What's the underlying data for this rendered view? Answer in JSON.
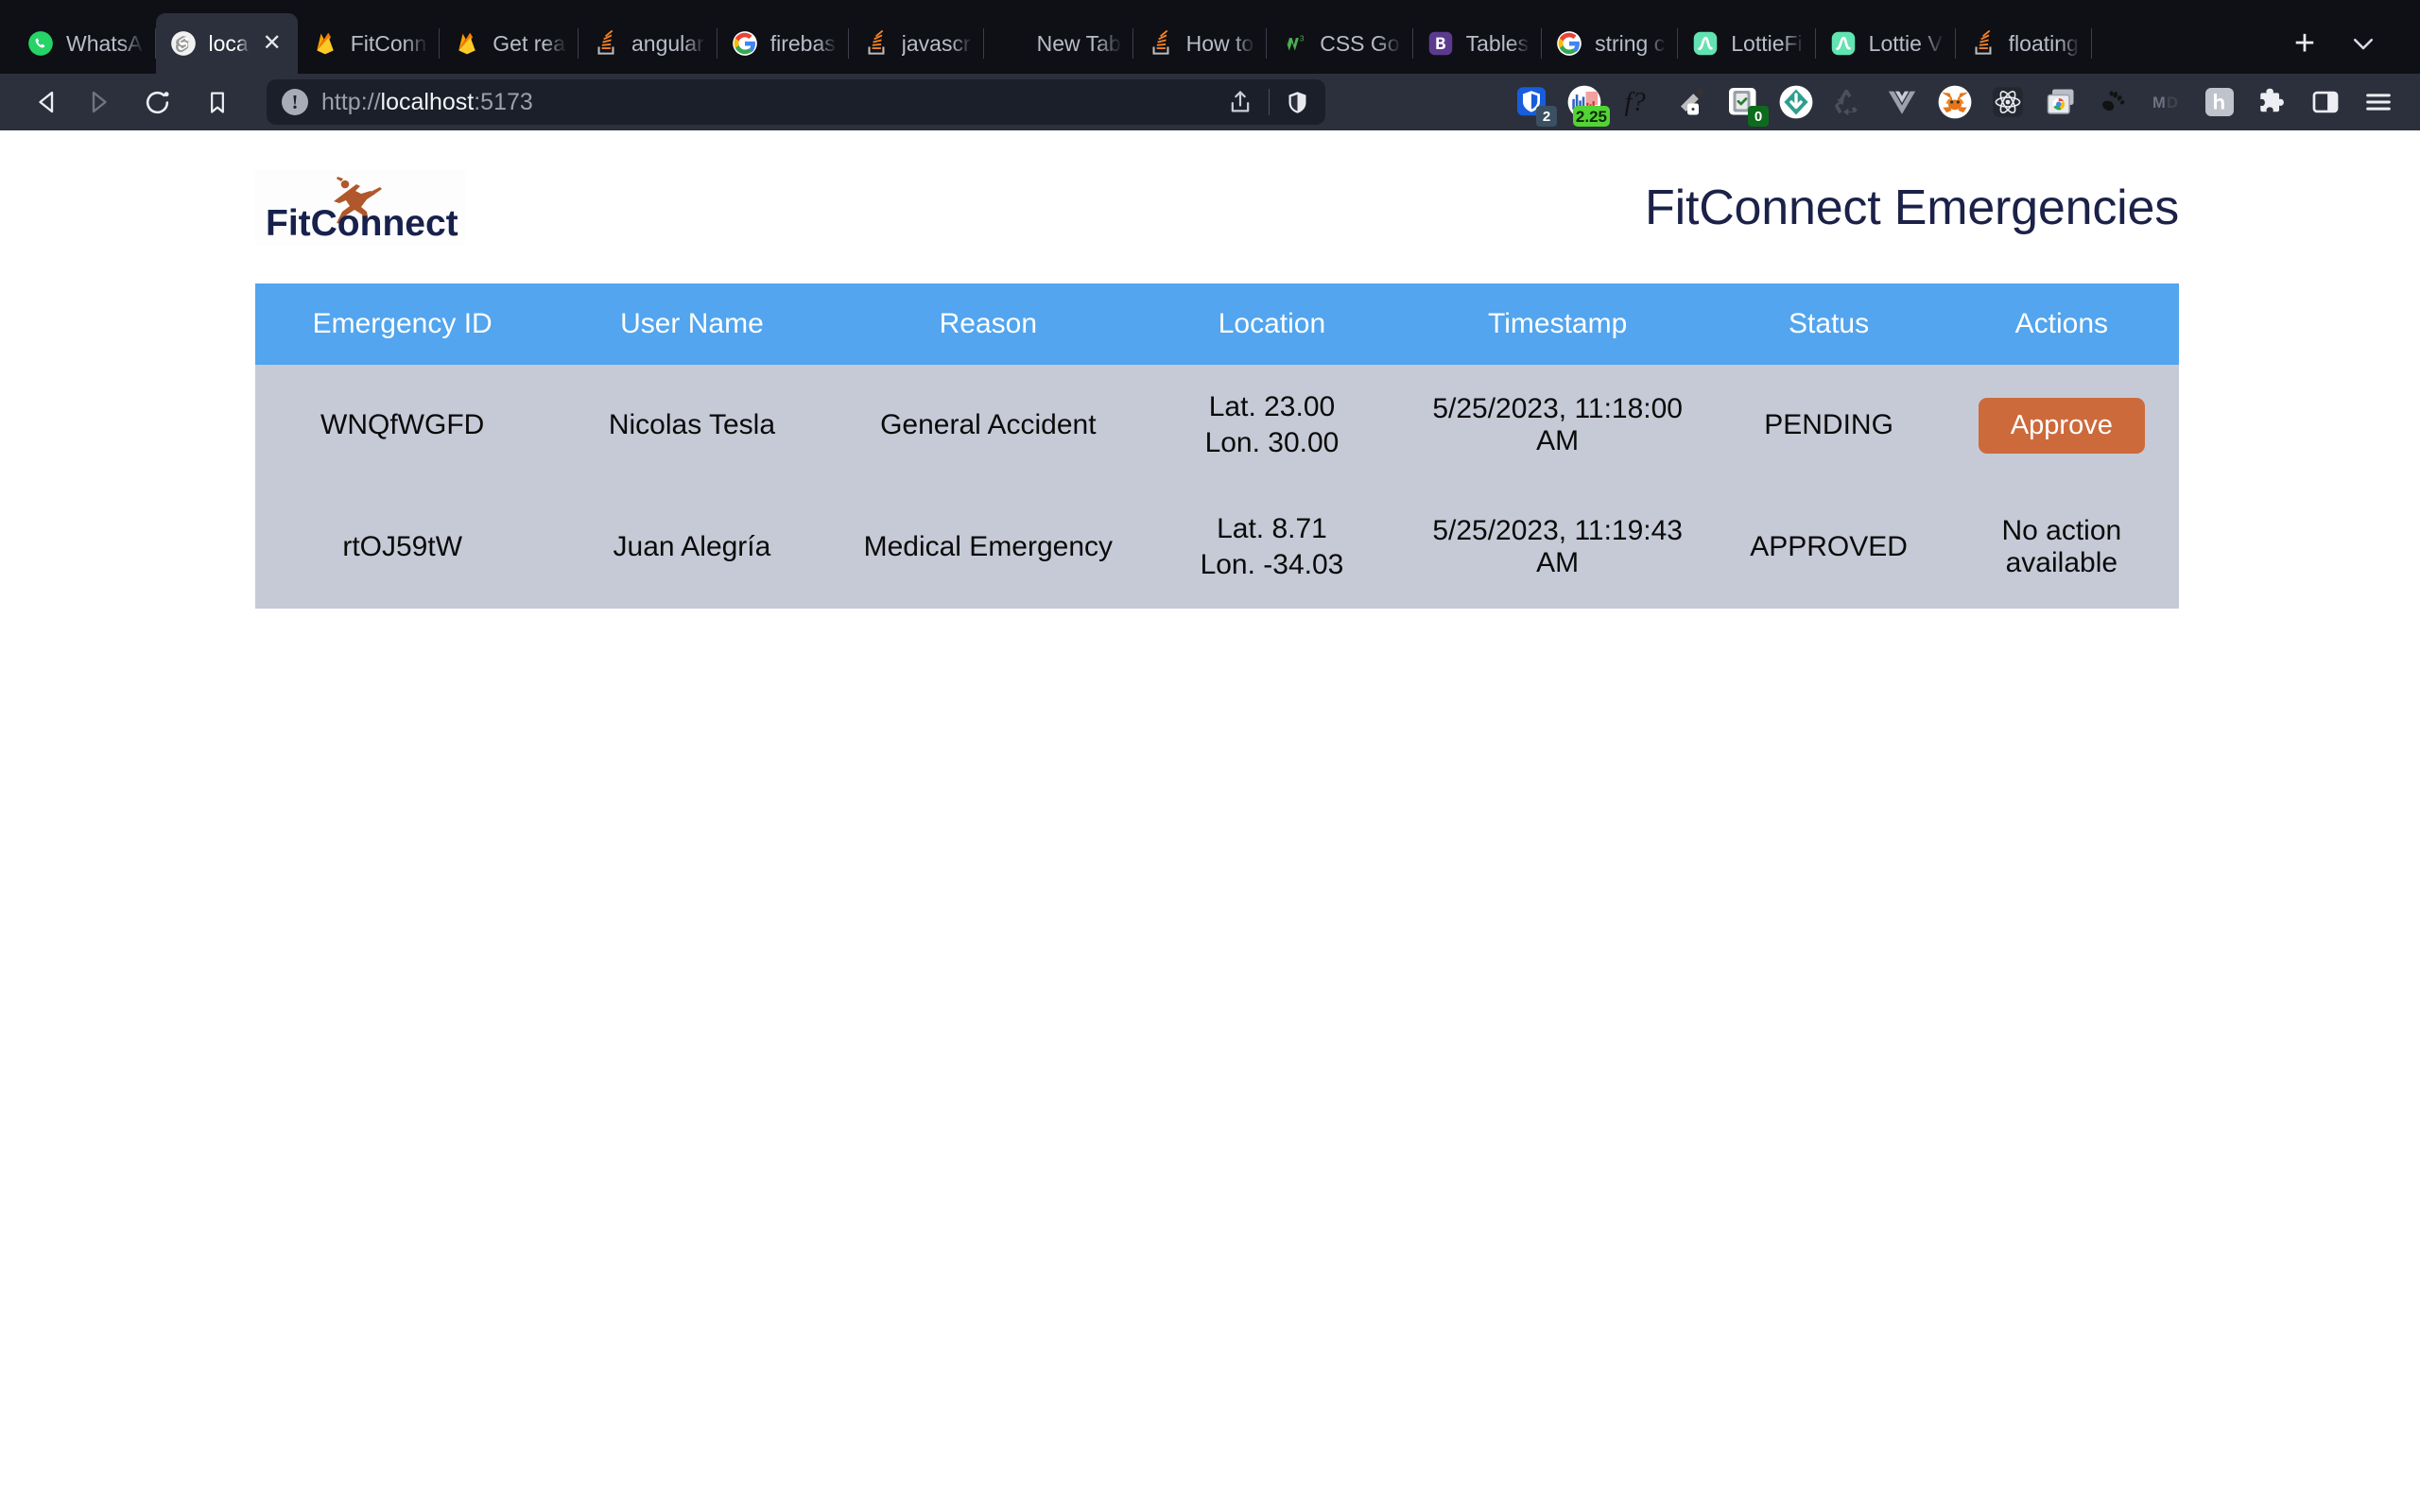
{
  "browser": {
    "tabs": [
      {
        "title": "WhatsA",
        "icon": "whatsapp-icon",
        "active": false
      },
      {
        "title": "loca",
        "icon": "svelte-icon",
        "active": true
      },
      {
        "title": "FitConn",
        "icon": "firebase-icon",
        "active": false
      },
      {
        "title": "Get rea",
        "icon": "firebase-icon",
        "active": false
      },
      {
        "title": "angular",
        "icon": "stackoverflow-icon",
        "active": false
      },
      {
        "title": "firebas",
        "icon": "google-icon",
        "active": false
      },
      {
        "title": "javascr",
        "icon": "stackoverflow-icon",
        "active": false
      },
      {
        "title": "New Tab",
        "icon": "blank-icon",
        "active": false
      },
      {
        "title": "How to",
        "icon": "stackoverflow-icon",
        "active": false
      },
      {
        "title": "CSS Go",
        "icon": "w3schools-icon",
        "active": false
      },
      {
        "title": "Tables",
        "icon": "bootstrap-icon",
        "active": false
      },
      {
        "title": "string c",
        "icon": "google-icon",
        "active": false
      },
      {
        "title": "LottieFi",
        "icon": "lottie-icon",
        "active": false
      },
      {
        "title": "Lottie V",
        "icon": "lottie-icon",
        "active": false
      },
      {
        "title": "floating",
        "icon": "stackoverflow-icon",
        "active": false
      }
    ],
    "new_tab_label": "+",
    "tab_list_icon": "chevron-down-icon",
    "close_tab_icon": "close-icon",
    "nav": {
      "back_icon": "back-arrow-icon",
      "forward_icon": "forward-arrow-icon",
      "reload_icon": "reload-icon",
      "bookmark_icon": "bookmark-icon",
      "share_icon": "share-icon",
      "shield_icon": "brave-shield-icon"
    },
    "url": {
      "scheme": "http://",
      "host": "localhost",
      "port": ":5173",
      "full": "http://localhost:5173",
      "security_icon": "not-secure-icon"
    },
    "extensions": [
      {
        "name": "bitwarden-icon",
        "badge": "2",
        "badge_style": "blue"
      },
      {
        "name": "stocks-chart-icon",
        "badge": "2.25",
        "badge_style": "green"
      },
      {
        "name": "wolfram-function-icon",
        "badge": "",
        "badge_style": ""
      },
      {
        "name": "color-picker-icon",
        "badge": "",
        "badge_style": ""
      },
      {
        "name": "clipboard-check-icon",
        "badge": "0",
        "badge_style": "darkgreen"
      },
      {
        "name": "download-manager-icon",
        "badge": "",
        "badge_style": ""
      },
      {
        "name": "recycle-icon",
        "badge": "",
        "badge_style": ""
      },
      {
        "name": "vue-devtools-icon",
        "badge": "",
        "badge_style": ""
      },
      {
        "name": "metamask-icon",
        "badge": "",
        "badge_style": ""
      },
      {
        "name": "react-devtools-icon",
        "badge": "",
        "badge_style": ""
      },
      {
        "name": "window-capture-icon",
        "badge": "",
        "badge_style": ""
      },
      {
        "name": "gnome-foot-icon",
        "badge": "",
        "badge_style": ""
      },
      {
        "name": "markdown-icon",
        "badge": "",
        "badge_style": ""
      },
      {
        "name": "hypothesis-icon",
        "badge": "",
        "badge_style": ""
      },
      {
        "name": "extensions-puzzle-icon",
        "badge": "",
        "badge_style": ""
      },
      {
        "name": "sidebar-toggle-icon",
        "badge": "",
        "badge_style": ""
      },
      {
        "name": "hamburger-menu-icon",
        "badge": "",
        "badge_style": ""
      }
    ]
  },
  "page": {
    "logo": {
      "name": "fitconnect-logo",
      "wordmark": "FitConnect",
      "wordmark_color": "#16214d",
      "runner_color": "#b0582c"
    },
    "title": "FitConnect Emergencies",
    "table": {
      "header_bg": "#52a5ee",
      "row_bg": "#c6cad6",
      "approve_color": "#cd6a3c",
      "columns": [
        "Emergency ID",
        "User Name",
        "Reason",
        "Location",
        "Timestamp",
        "Status",
        "Actions"
      ],
      "rows": [
        {
          "emergency_id": "WNQfWGFD",
          "user_name": "Nicolas Tesla",
          "reason": "General Accident",
          "location_lat": "Lat. 23.00",
          "location_lon": "Lon. 30.00",
          "timestamp": "5/25/2023, 11:18:00 AM",
          "status": "PENDING",
          "action_label": "Approve",
          "action_type": "button"
        },
        {
          "emergency_id": "rtOJ59tW",
          "user_name": "Juan Alegría",
          "reason": "Medical Emergency",
          "location_lat": "Lat. 8.71",
          "location_lon": "Lon. -34.03",
          "timestamp": "5/25/2023, 11:19:43 AM",
          "status": "APPROVED",
          "action_label": "No action available",
          "action_type": "text"
        }
      ]
    }
  }
}
